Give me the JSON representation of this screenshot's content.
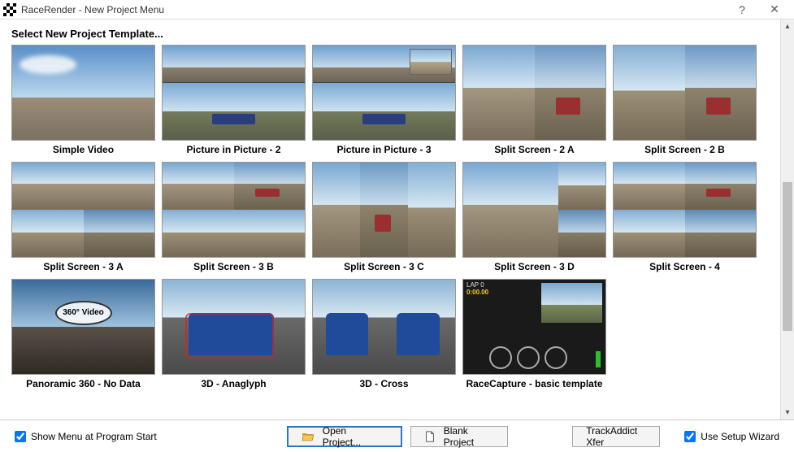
{
  "window": {
    "title": "RaceRender - New Project Menu",
    "help_glyph": "?",
    "close_glyph": "✕"
  },
  "heading": "Select New Project Template...",
  "templates": [
    {
      "label": "Simple Video",
      "kind": "simple"
    },
    {
      "label": "Picture in Picture - 2",
      "kind": "pip2"
    },
    {
      "label": "Picture in Picture - 3",
      "kind": "pip3"
    },
    {
      "label": "Split Screen - 2 A",
      "kind": "split2a"
    },
    {
      "label": "Split Screen - 2 B",
      "kind": "split2b"
    },
    {
      "label": "Split Screen - 3 A",
      "kind": "split3a"
    },
    {
      "label": "Split Screen - 3 B",
      "kind": "split3b"
    },
    {
      "label": "Split Screen - 3 C",
      "kind": "split3c"
    },
    {
      "label": "Split Screen - 3 D",
      "kind": "split3d"
    },
    {
      "label": "Split Screen - 4",
      "kind": "split4"
    },
    {
      "label": "Panoramic 360 - No Data",
      "kind": "pano",
      "badge": "360° Video"
    },
    {
      "label": "3D - Anaglyph",
      "kind": "anaglyph"
    },
    {
      "label": "3D - Cross",
      "kind": "cross"
    },
    {
      "label": "RaceCapture - basic template",
      "kind": "racecap",
      "lap": "LAP 0",
      "time": "0:00.00"
    }
  ],
  "footer": {
    "show_menu_label": "Show Menu at Program Start",
    "show_menu_checked": true,
    "open_project_label": "Open Project...",
    "blank_project_label": "Blank Project",
    "trackaddict_label": "TrackAddict Xfer",
    "wizard_label": "Use Setup Wizard",
    "wizard_checked": true
  }
}
